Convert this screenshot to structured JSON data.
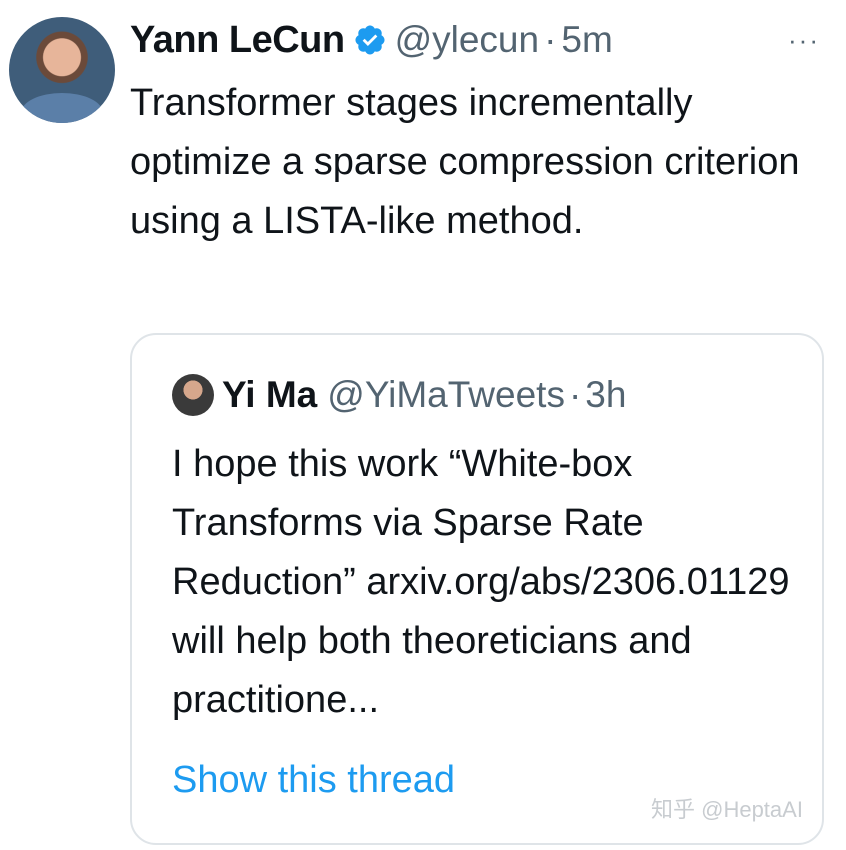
{
  "tweet": {
    "author_name": "Yann LeCun",
    "verified_icon": "verified-badge-icon",
    "handle": "@ylecun",
    "separator": "·",
    "time": "5m",
    "more": "···",
    "text": "Transformer stages incrementally optimize a sparse compression criterion using a LISTA-like method."
  },
  "quote": {
    "author_name": "Yi Ma",
    "handle": "@YiMaTweets",
    "separator": "·",
    "time": "3h",
    "text": "I hope this work “White-box Transforms via Sparse Rate Reduction” arxiv.org/abs/2306.01129 will help both theoreticians and practitione...",
    "show_thread": "Show this thread"
  },
  "watermark": "知乎 @HeptaAI",
  "colors": {
    "accent": "#1d9bf0",
    "secondary_text": "#536471",
    "border": "#dfe4e8"
  }
}
